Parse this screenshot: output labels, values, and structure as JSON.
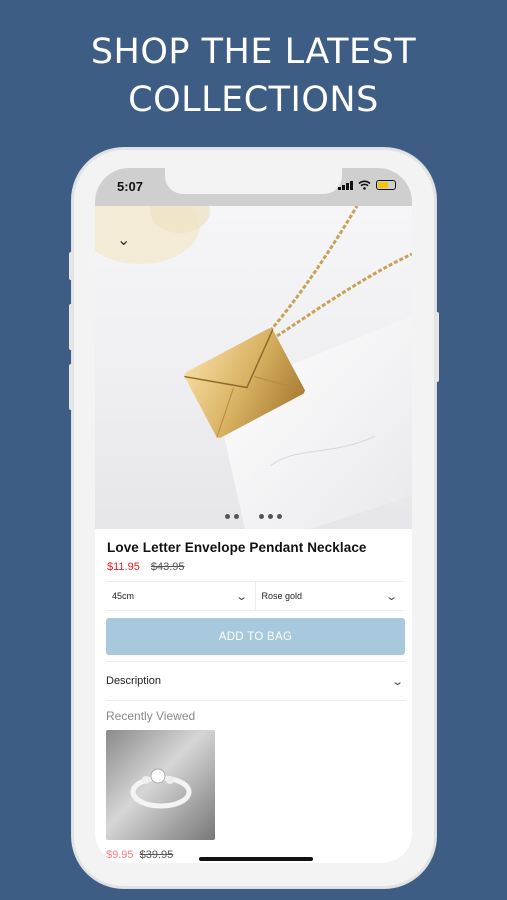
{
  "headline": {
    "line1": "SHOP THE LATEST",
    "line2": "COLLECTIONS"
  },
  "status_bar": {
    "time": "5:07"
  },
  "gallery": {
    "page_count": 5,
    "active_index": 0
  },
  "product": {
    "title": "Love Letter Envelope Pendant Necklace",
    "sale_price": "$11.95",
    "original_price": "$43.95"
  },
  "options": {
    "length": "45cm",
    "color": "Rose gold"
  },
  "add_to_bag_label": "ADD TO BAG",
  "description_label": "Description",
  "recently_viewed": {
    "label": "Recently Viewed",
    "items": [
      {
        "sale_price": "$9.95",
        "original_price": "$39.95"
      }
    ]
  },
  "colors": {
    "background": "#3d5d85",
    "sale_price": "#e02020",
    "add_button": "#a8c8de",
    "battery": "#f1c40f"
  }
}
